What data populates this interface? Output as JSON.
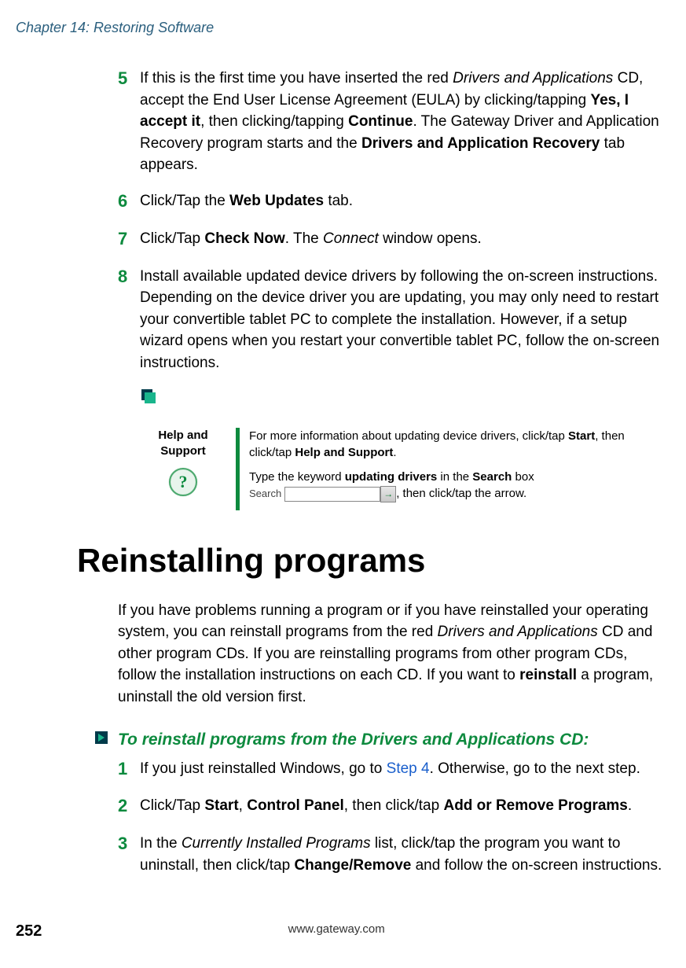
{
  "chapter_header": "Chapter 14: Restoring Software",
  "steps_first": [
    {
      "num": "5",
      "parts": [
        {
          "t": "If this is the first time you have inserted the red ",
          "cls": ""
        },
        {
          "t": "Drivers and Applications",
          "cls": "italic"
        },
        {
          "t": " CD, accept the End User License Agreement (EULA) by clicking/tapping ",
          "cls": ""
        },
        {
          "t": "Yes, I accept it",
          "cls": "bold"
        },
        {
          "t": ", then clicking/tapping ",
          "cls": ""
        },
        {
          "t": "Continue",
          "cls": "bold"
        },
        {
          "t": ". The Gateway Driver and Application Recovery program starts and the ",
          "cls": ""
        },
        {
          "t": "Drivers and Application Recovery",
          "cls": "bold"
        },
        {
          "t": " tab appears.",
          "cls": ""
        }
      ]
    },
    {
      "num": "6",
      "parts": [
        {
          "t": "Click/Tap the ",
          "cls": ""
        },
        {
          "t": "Web Updates",
          "cls": "bold"
        },
        {
          "t": " tab.",
          "cls": ""
        }
      ]
    },
    {
      "num": "7",
      "parts": [
        {
          "t": "Click/Tap ",
          "cls": ""
        },
        {
          "t": "Check Now",
          "cls": "bold"
        },
        {
          "t": ". The ",
          "cls": ""
        },
        {
          "t": "Connect",
          "cls": "italic"
        },
        {
          "t": " window opens.",
          "cls": ""
        }
      ]
    },
    {
      "num": "8",
      "parts": [
        {
          "t": "Install available updated device drivers by following the on-screen instructions. Depending on the device driver you are updating, you may only need to restart your convertible tablet PC to complete the installation. However, if a setup wizard opens when you restart your convertible tablet PC, follow the on-screen instructions.",
          "cls": ""
        }
      ]
    }
  ],
  "help": {
    "label": "Help and Support",
    "line1_pre": "For more information about updating device drivers, click/tap ",
    "start": "Start",
    "line1_mid": ", then click/tap ",
    "help_support": "Help and Support",
    "line1_end": ".",
    "line2_pre": "Type the keyword ",
    "keyword": "updating drivers",
    "line2_in": " in the ",
    "search_word": "Search",
    "line2_box": " box ",
    "search_label": "Search",
    "line2_end": ", then click/tap the arrow."
  },
  "section_title": "Reinstalling programs",
  "intro": [
    {
      "t": "If you have problems running a program or if you have reinstalled your operating system, you can reinstall programs from the red ",
      "cls": ""
    },
    {
      "t": "Drivers and Applications",
      "cls": "italic"
    },
    {
      "t": " CD and other program CDs. If you are reinstalling programs from other program CDs, follow the installation instructions on each CD. If you want to ",
      "cls": ""
    },
    {
      "t": "reinstall",
      "cls": "bold"
    },
    {
      "t": " a program, uninstall the old version first.",
      "cls": ""
    }
  ],
  "procedure_heading": "To reinstall programs from the Drivers and Applications CD:",
  "steps_second": [
    {
      "num": "1",
      "parts": [
        {
          "t": "If you just reinstalled Windows, go to ",
          "cls": ""
        },
        {
          "t": "Step 4",
          "cls": "link-blue"
        },
        {
          "t": ". Otherwise, go to the next step.",
          "cls": ""
        }
      ]
    },
    {
      "num": "2",
      "parts": [
        {
          "t": "Click/Tap ",
          "cls": ""
        },
        {
          "t": "Start",
          "cls": "bold"
        },
        {
          "t": ", ",
          "cls": ""
        },
        {
          "t": "Control Panel",
          "cls": "bold"
        },
        {
          "t": ", then click/tap ",
          "cls": ""
        },
        {
          "t": "Add or Remove Programs",
          "cls": "bold"
        },
        {
          "t": ".",
          "cls": ""
        }
      ]
    },
    {
      "num": "3",
      "parts": [
        {
          "t": "In the ",
          "cls": ""
        },
        {
          "t": "Currently Installed Programs",
          "cls": "italic"
        },
        {
          "t": " list, click/tap the program you want to uninstall, then click/tap ",
          "cls": ""
        },
        {
          "t": "Change/Remove",
          "cls": "bold"
        },
        {
          "t": " and follow the on-screen instructions.",
          "cls": ""
        }
      ]
    }
  ],
  "page_number": "252",
  "footer_url": "www.gateway.com"
}
